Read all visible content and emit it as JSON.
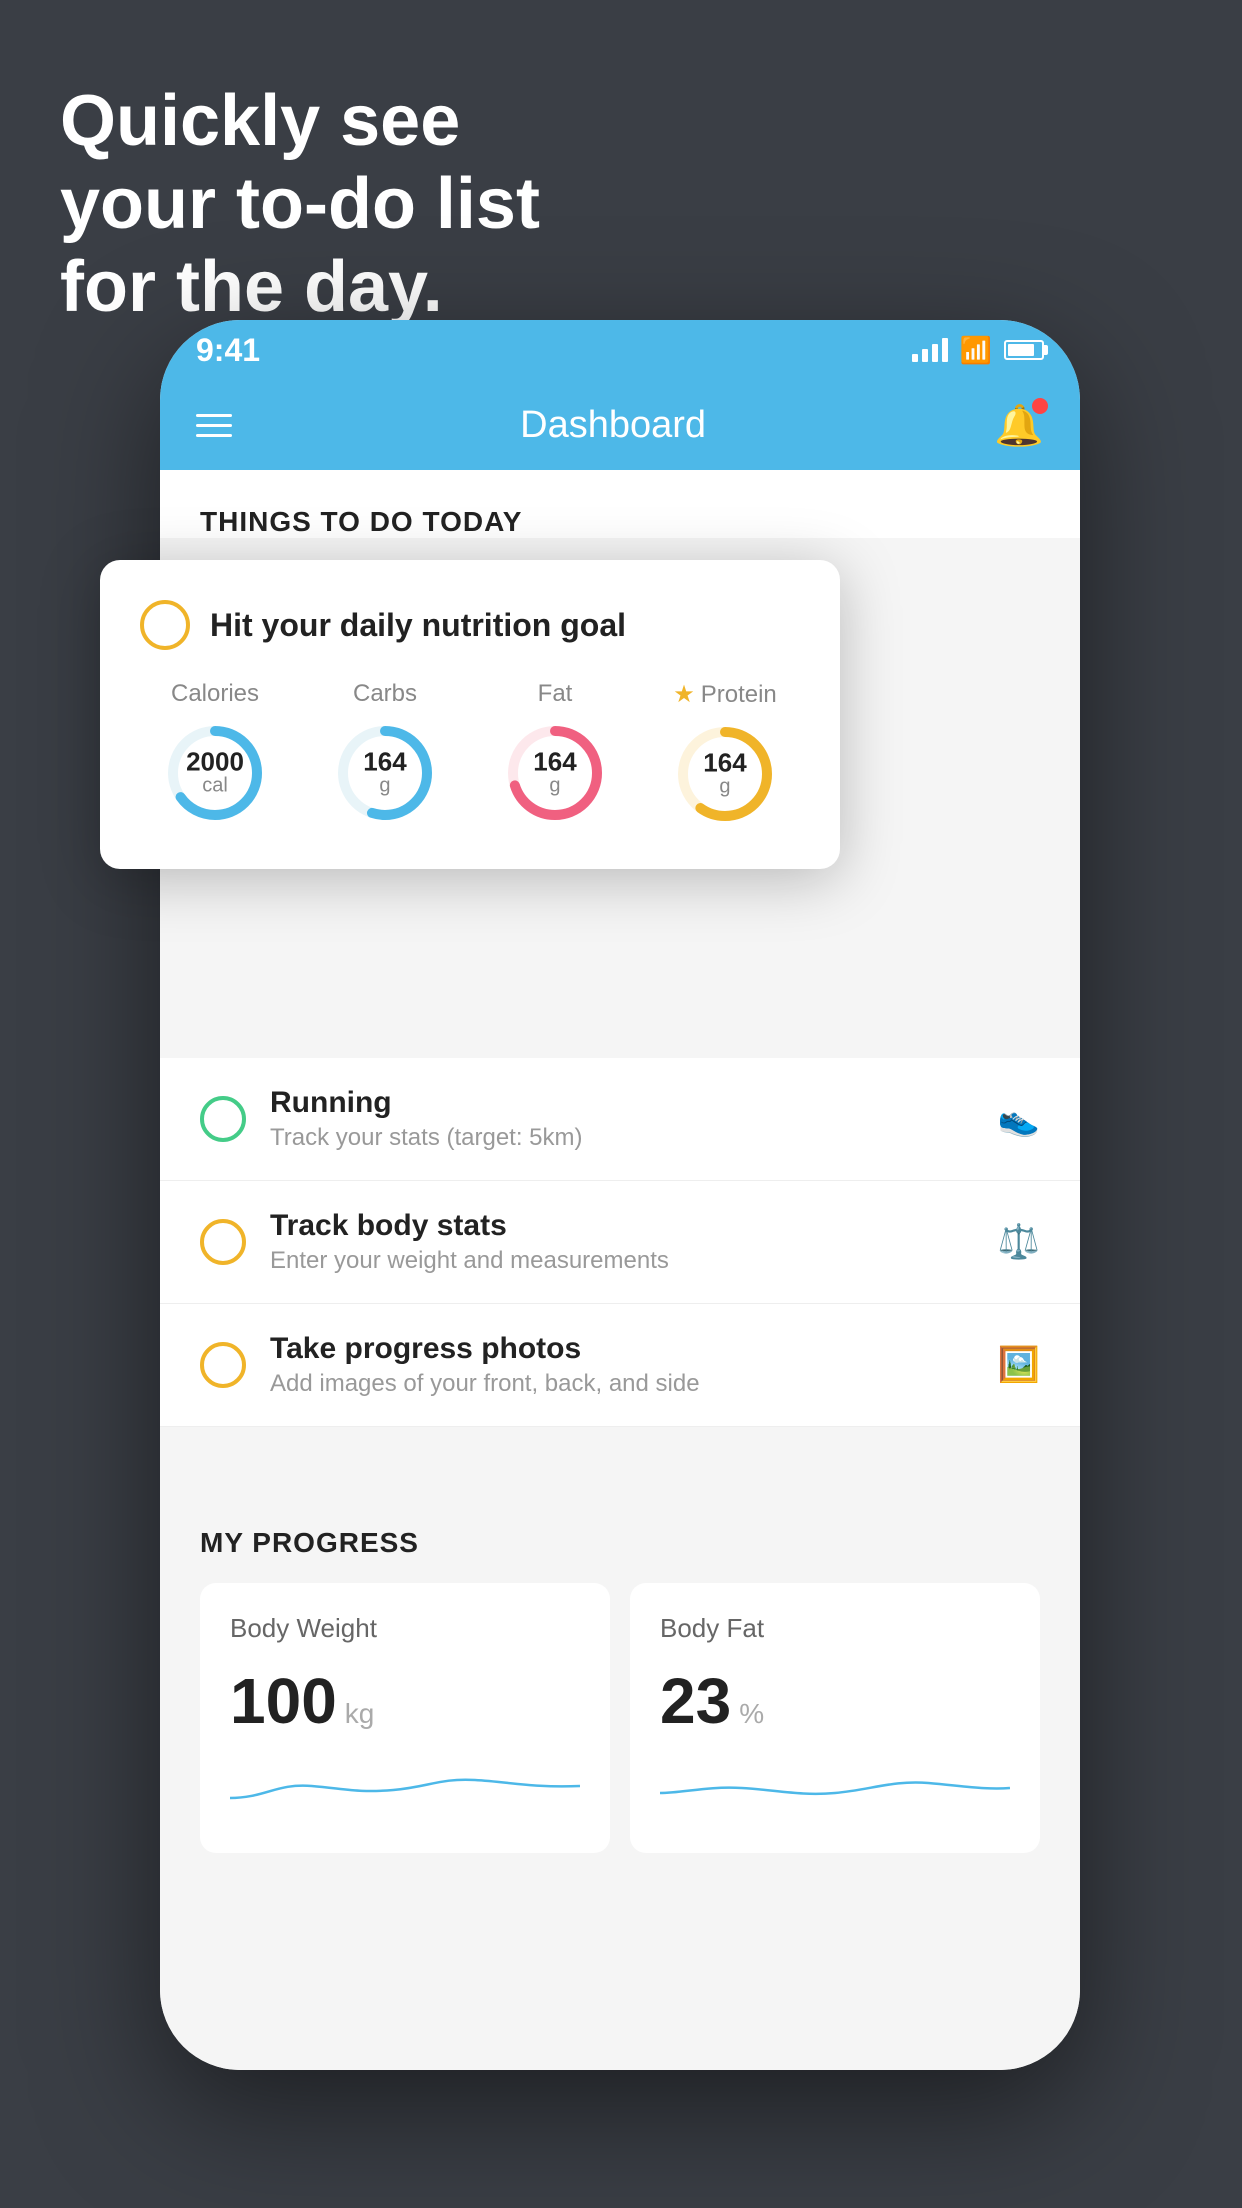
{
  "background": {
    "color": "#3a3e45"
  },
  "headline": {
    "line1": "Quickly see",
    "line2": "your to-do list",
    "line3": "for the day."
  },
  "phone": {
    "statusBar": {
      "time": "9:41"
    },
    "header": {
      "title": "Dashboard"
    },
    "thingsSection": {
      "title": "THINGS TO DO TODAY"
    },
    "nutritionCard": {
      "checkCircleColor": "#f0b429",
      "title": "Hit your daily nutrition goal",
      "stats": [
        {
          "label": "Calories",
          "value": "2000",
          "unit": "cal",
          "color": "#4db8e8",
          "percent": 65
        },
        {
          "label": "Carbs",
          "value": "164",
          "unit": "g",
          "color": "#4db8e8",
          "percent": 55
        },
        {
          "label": "Fat",
          "value": "164",
          "unit": "g",
          "color": "#f06080",
          "percent": 70
        },
        {
          "label": "Protein",
          "value": "164",
          "unit": "g",
          "color": "#f0b429",
          "percent": 60,
          "starred": true
        }
      ]
    },
    "todoItems": [
      {
        "name": "Running",
        "desc": "Track your stats (target: 5km)",
        "circleColor": "green",
        "icon": "👟"
      },
      {
        "name": "Track body stats",
        "desc": "Enter your weight and measurements",
        "circleColor": "yellow",
        "icon": "⚖️"
      },
      {
        "name": "Take progress photos",
        "desc": "Add images of your front, back, and side",
        "circleColor": "yellow",
        "icon": "🖼️"
      }
    ],
    "progressSection": {
      "title": "MY PROGRESS",
      "cards": [
        {
          "title": "Body Weight",
          "value": "100",
          "unit": "kg"
        },
        {
          "title": "Body Fat",
          "value": "23",
          "unit": "%"
        }
      ]
    }
  }
}
